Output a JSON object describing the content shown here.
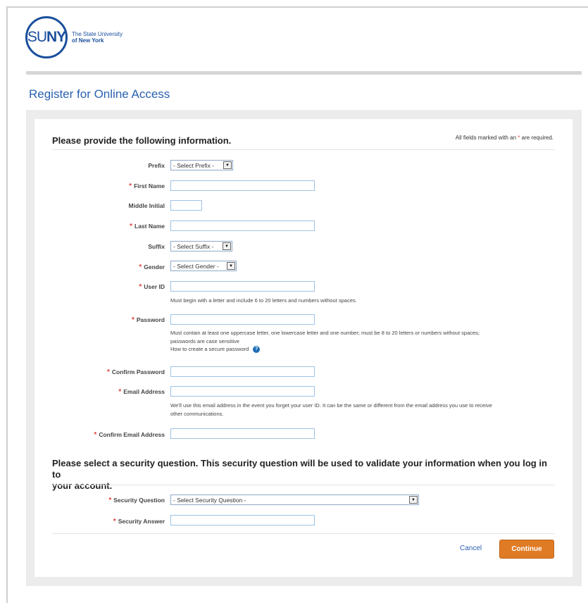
{
  "logo": {
    "abbr_su": "SU",
    "abbr_ny": "NY",
    "line1": "The State University",
    "line2": "of New York"
  },
  "page_title": "Register for Online Access",
  "section1": {
    "heading": "Please provide the following information.",
    "required_note_pre": "All fields marked with an",
    "required_note_star": "*",
    "required_note_post": "are required."
  },
  "fields": {
    "prefix": {
      "label": "Prefix",
      "value": "- Select Prefix -"
    },
    "first_name": {
      "label": "First Name",
      "value": ""
    },
    "middle_initial": {
      "label": "Middle Initial",
      "value": ""
    },
    "last_name": {
      "label": "Last Name",
      "value": ""
    },
    "suffix": {
      "label": "Suffix",
      "value": "- Select Suffix -"
    },
    "gender": {
      "label": "Gender",
      "value": "- Select Gender -"
    },
    "user_id": {
      "label": "User ID",
      "value": "",
      "help": "Must begin with a letter and include 6 to 20 letters and numbers without spaces."
    },
    "password": {
      "label": "Password",
      "value": "",
      "help_line1": "Must contain at least one uppercase letter, one lowercase letter and one number; must be 8 to 20 letters or numbers without spaces;",
      "help_line2": "passwords are case sensitive",
      "help_link": "How to create a secure password"
    },
    "confirm_password": {
      "label": "Confirm Password",
      "value": ""
    },
    "email": {
      "label": "Email Address",
      "value": "",
      "help_line1": "We'll use this email address in the event you forget your user ID. It can be the same or different from the email address you use to receive",
      "help_line2": "other communications."
    },
    "confirm_email": {
      "label": "Confirm Email Address",
      "value": ""
    }
  },
  "section2": {
    "heading_line1": "Please select a security question. This security question will be used to validate your information when you log in to",
    "heading_line2": "your account."
  },
  "security": {
    "question": {
      "label": "Security Question",
      "value": "- Select Security Question -"
    },
    "answer": {
      "label": "Security Answer",
      "value": ""
    }
  },
  "actions": {
    "cancel": "Cancel",
    "continue": "Continue"
  },
  "required_star": "*",
  "dropdown_glyph": "▼",
  "help_glyph": "?",
  "colors": {
    "brand_blue": "#1a4f9c",
    "link_blue": "#2a62b0",
    "required_red": "#e0423c",
    "continue_orange": "#e07b25",
    "input_border": "#9dc3e6"
  },
  "icons": {
    "dropdown": "chevron-down-icon",
    "help": "help-circle-icon"
  }
}
